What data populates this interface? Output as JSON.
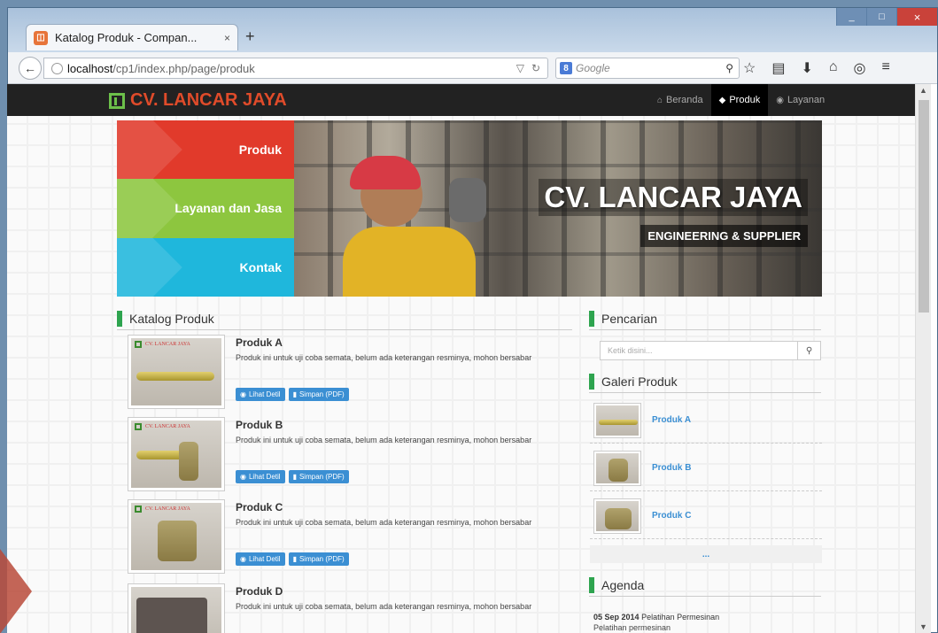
{
  "browser": {
    "tab_title": "Katalog Produk - Compan...",
    "tab_close": "×",
    "new_tab": "+",
    "url_host": "localhost",
    "url_path": "/cp1/index.php/page/produk",
    "search_engine": "Google",
    "window_buttons": [
      "_",
      "□",
      "×"
    ]
  },
  "site": {
    "logo_text": "CV. LANCAR JAYA",
    "nav": [
      {
        "label": "Beranda",
        "icon": "home-icon",
        "active": false
      },
      {
        "label": "Produk",
        "icon": "tag-icon",
        "active": true
      },
      {
        "label": "Layanan",
        "icon": "globe-icon",
        "active": false
      }
    ]
  },
  "banner": {
    "menu": [
      "Produk",
      "Layanan dan Jasa",
      "Kontak"
    ],
    "title": "CV. LANCAR JAYA",
    "subtitle": "ENGINEERING & SUPPLIER",
    "colors": {
      "red": "#e13a2b",
      "green": "#8dc63f",
      "blue": "#1fb7dc"
    }
  },
  "catalog": {
    "heading": "Katalog Produk",
    "products": [
      {
        "name": "Produk A",
        "desc": "Produk ini untuk uji coba semata, belum ada keterangan resminya, mohon bersabar",
        "detail_label": "Lihat Detil",
        "pdf_label": "Simpan (PDF)"
      },
      {
        "name": "Produk B",
        "desc": "Produk ini untuk uji coba semata, belum ada keterangan resminya, mohon bersabar",
        "detail_label": "Lihat Detil",
        "pdf_label": "Simpan (PDF)"
      },
      {
        "name": "Produk C",
        "desc": "Produk ini untuk uji coba semata, belum ada keterangan resminya, mohon bersabar",
        "detail_label": "Lihat Detil",
        "pdf_label": "Simpan (PDF)"
      },
      {
        "name": "Produk D",
        "desc": "Produk ini untuk uji coba semata, belum ada keterangan resminya, mohon bersabar"
      }
    ]
  },
  "sidebar": {
    "search_heading": "Pencarian",
    "search_placeholder": "Ketik disini...",
    "gallery_heading": "Galeri Produk",
    "gallery": [
      "Produk A",
      "Produk B",
      "Produk C"
    ],
    "gallery_more": "...",
    "agenda_heading": "Agenda",
    "agenda_date": "05 Sep 2014",
    "agenda_title": "Pelatihan Permesinan",
    "agenda_desc": "Pelatihan permesinan"
  },
  "thumb_label": "CV. LANCAR JAYA"
}
